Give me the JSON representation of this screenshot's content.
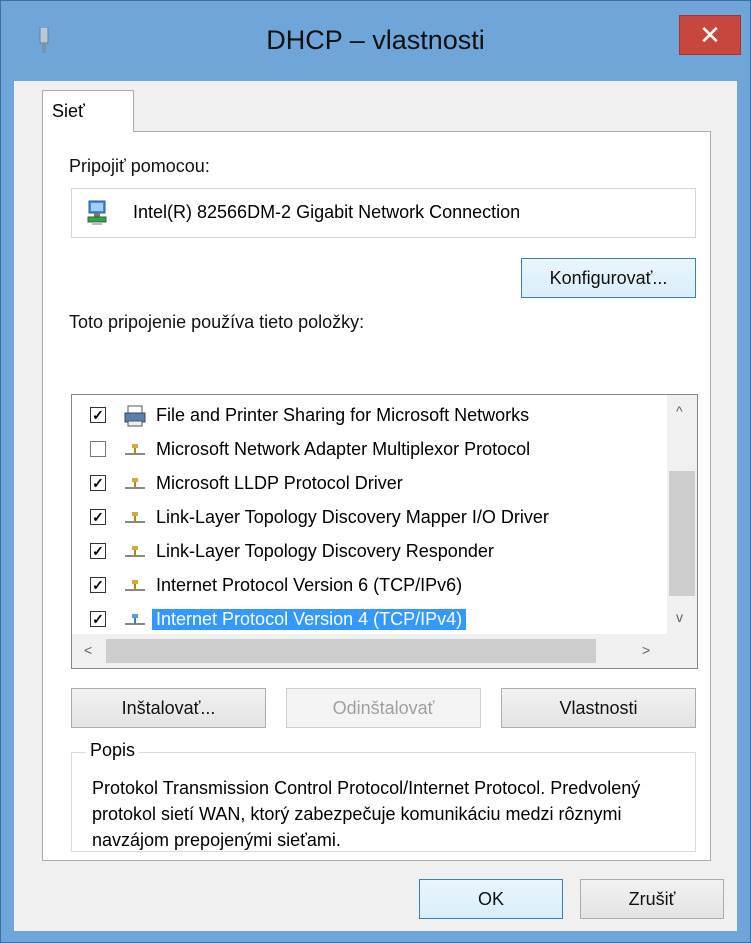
{
  "window": {
    "title": "DHCP – vlastnosti",
    "close_glyph": "✕"
  },
  "tabs": [
    {
      "label": "Sieť"
    }
  ],
  "connect": {
    "label": "Pripojiť pomocou:",
    "adapter": "Intel(R) 82566DM-2 Gigabit Network Connection",
    "configure_button": "Konfigurovať..."
  },
  "items_label": "Toto pripojenie používa tieto položky:",
  "items": [
    {
      "label": "File and Printer Sharing for Microsoft Networks",
      "checked": true,
      "icon": "printer-share-icon"
    },
    {
      "label": "Microsoft Network Adapter Multiplexor Protocol",
      "checked": false,
      "icon": "protocol-icon"
    },
    {
      "label": "Microsoft LLDP Protocol Driver",
      "checked": true,
      "icon": "protocol-icon"
    },
    {
      "label": "Link-Layer Topology Discovery Mapper I/O Driver",
      "checked": true,
      "icon": "protocol-icon"
    },
    {
      "label": "Link-Layer Topology Discovery Responder",
      "checked": true,
      "icon": "protocol-icon"
    },
    {
      "label": "Internet Protocol Version 6 (TCP/IPv6)",
      "checked": true,
      "icon": "protocol-icon"
    },
    {
      "label": "Internet Protocol Version 4 (TCP/IPv4)",
      "checked": true,
      "icon": "protocol-icon",
      "selected": true
    }
  ],
  "scroll_glyphs": {
    "up": "^",
    "down": "v",
    "left": "<",
    "right": ">"
  },
  "buttons": {
    "install": "Inštalovať...",
    "uninstall": "Odinštalovať",
    "properties": "Vlastnosti"
  },
  "description": {
    "title": "Popis",
    "text": "Protokol Transmission Control Protocol/Internet Protocol. Predvolený protokol sietí WAN, ktorý zabezpečuje komunikáciu medzi rôznymi navzájom prepojenými sieťami."
  },
  "footer": {
    "ok": "OK",
    "cancel": "Zrušiť"
  },
  "colors": {
    "selection": "#3399ff",
    "close": "#c7463e",
    "frame": "#6fa5d8"
  }
}
